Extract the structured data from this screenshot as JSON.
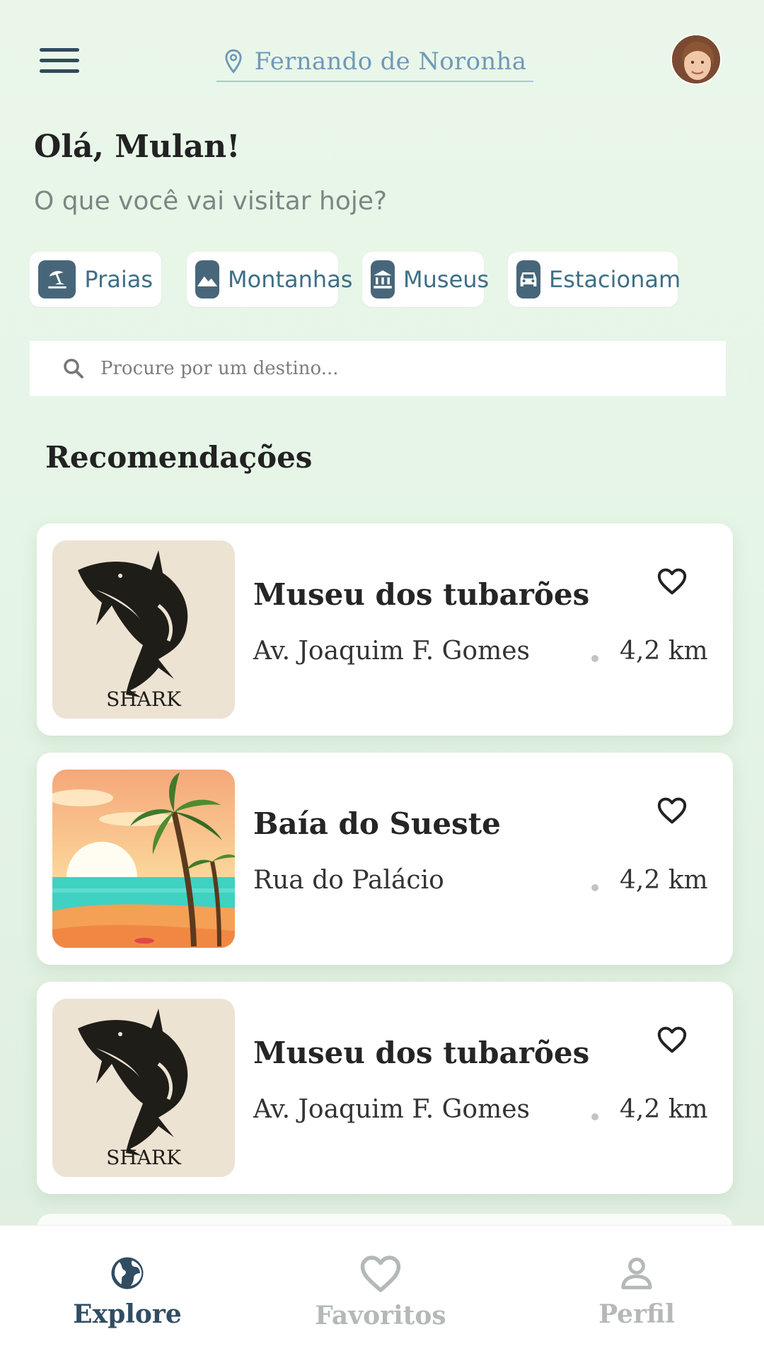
{
  "header": {
    "location": "Fernando de Noronha"
  },
  "greeting": {
    "title": "Olá, Mulan!",
    "subtitle": "O que você vai visitar hoje?"
  },
  "categories": [
    {
      "label": "Praias",
      "icon": "beach-umbrella-icon"
    },
    {
      "label": "Montanhas",
      "icon": "mountain-icon"
    },
    {
      "label": "Museus",
      "icon": "museum-icon"
    },
    {
      "label": "Estacionam",
      "icon": "car-icon"
    }
  ],
  "search": {
    "placeholder": "Procure por um destino..."
  },
  "recommendations": {
    "title": "Recomendações",
    "items": [
      {
        "name": "Museu dos tubarões",
        "address": "Av. Joaquim F. Gomes",
        "distance": "4,2 km",
        "image": "shark-illustration",
        "image_caption": "SHARK"
      },
      {
        "name": "Baía do Sueste",
        "address": "Rua do Palácio",
        "distance": "4,2 km",
        "image": "beach-sunset-illustration"
      },
      {
        "name": "Museu dos tubarões",
        "address": "Av. Joaquim F. Gomes",
        "distance": "4,2 km",
        "image": "shark-illustration",
        "image_caption": "SHARK"
      }
    ]
  },
  "tabbar": {
    "explore": "Explore",
    "favorites": "Favoritos",
    "profile": "Perfil"
  },
  "colors": {
    "background": "#e5f5e6",
    "primary": "#304d62",
    "accent_blue": "#6f99b8",
    "chip_icon_bg": "#48667a",
    "inactive": "#b4b9b8"
  }
}
